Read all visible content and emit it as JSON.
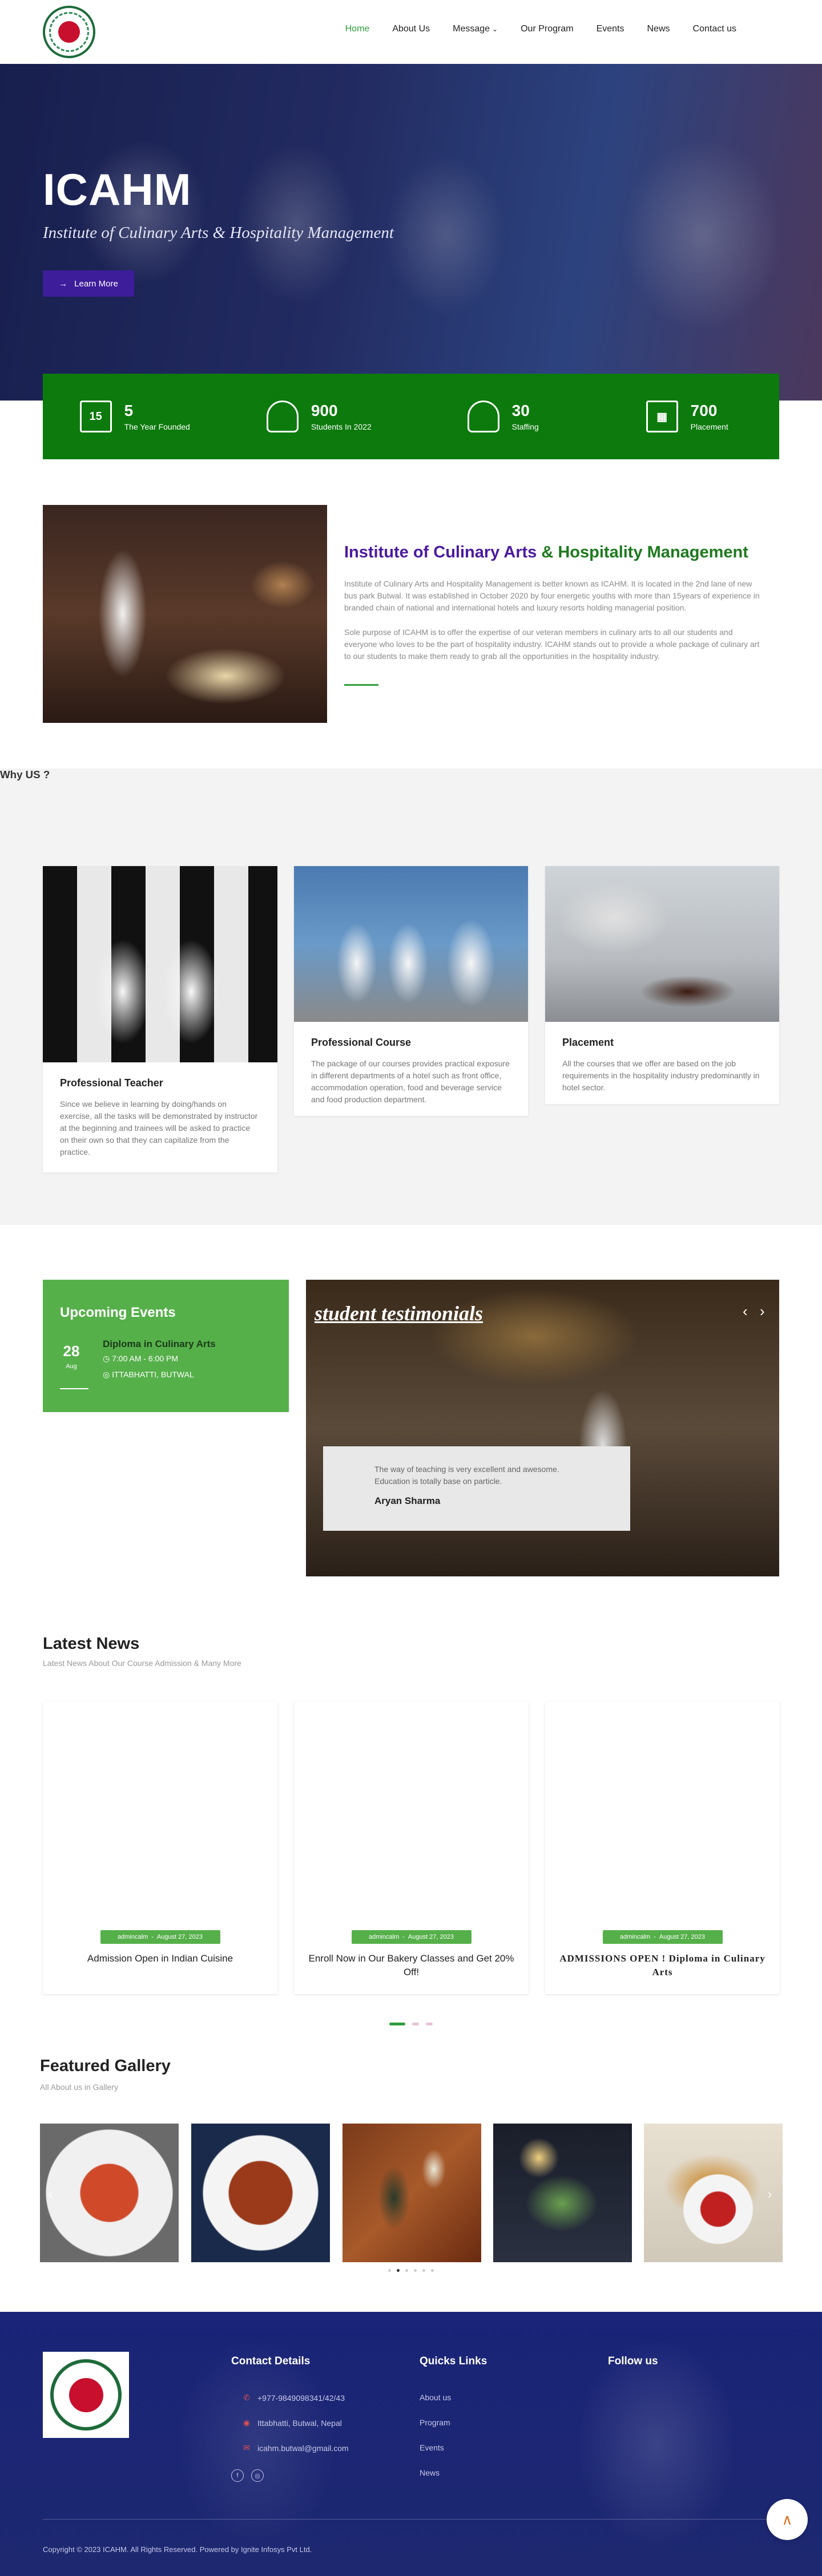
{
  "nav": {
    "items": [
      {
        "label": "Home"
      },
      {
        "label": "About Us"
      },
      {
        "label": "Message"
      },
      {
        "label": "Our Program"
      },
      {
        "label": "Events"
      },
      {
        "label": "News"
      },
      {
        "label": "Contact us"
      }
    ]
  },
  "hero": {
    "title": "ICAHM",
    "subtitle": "Institute of Culinary Arts & Hospitality Management",
    "button": "Learn More"
  },
  "stats": [
    {
      "icon": "calendar-icon",
      "icon_text": "15",
      "value": "5",
      "label": "The Year Founded"
    },
    {
      "icon": "users-icon",
      "icon_text": "",
      "value": "900",
      "label": "Students In 2022"
    },
    {
      "icon": "users-icon",
      "icon_text": "",
      "value": "30",
      "label": "Staffing"
    },
    {
      "icon": "network-icon",
      "icon_text": "",
      "value": "700",
      "label": "Placement"
    }
  ],
  "about": {
    "title_part1": "Institute of Culinary Arts ",
    "title_amp": "&",
    "title_part2": " Hospitality Management",
    "p1": "Institute of Culinary Arts and Hospitality Management is better known as ICAHM. It is located in the 2nd lane of new bus park Butwal. It was established in October 2020 by four energetic youths with more than 15years of experience in branded chain of national and international hotels and luxury resorts holding managerial position.",
    "p2": "Sole purpose of ICAHM is to offer the expertise of our veteran members in culinary arts to all our students and everyone who loves to be the part of hospitality industry. ICAHM stands out to provide a whole package of culinary art to our students to make them ready to grab all the opportunities in the hospitality industry."
  },
  "why": {
    "heading": "Why US ?",
    "cards": [
      {
        "title": "Professional Teacher",
        "text": "Since we believe in learning by doing/hands on exercise, all the tasks will be demonstrated by instructor at the beginning and trainees will be asked to practice on their own so that they can capitalize from the practice."
      },
      {
        "title": "Professional Course",
        "text": "The package of our courses provides practical exposure in different departments of a hotel such as front office, accommodation operation, food and beverage service and food production department."
      },
      {
        "title": "Placement",
        "text": "All the courses that we offer are based on the job requirements in the hospitality industry predominantly in hotel sector."
      }
    ]
  },
  "events": {
    "heading": "Upcoming Events",
    "day": "28",
    "month": "Aug",
    "title": "Diploma in Culinary Arts",
    "time": "7:00 AM - 6:00 PM",
    "location": "ITTABHATTI, BUTWAL"
  },
  "testimonials": {
    "heading": "student testimonials",
    "prev": "‹",
    "next": "›",
    "quote": "The way of teaching is very excellent and awesome. Education is totally base on particle.",
    "author": "Aryan Sharma"
  },
  "news": {
    "heading": "Latest News",
    "subheading": "Latest News About Our Course Admission & Many More",
    "items": [
      {
        "author": "admincalm",
        "date": "August 27, 2023",
        "title": "Admission Open in Indian Cuisine"
      },
      {
        "author": "admincalm",
        "date": "August 27, 2023",
        "title": "Enroll Now in Our Bakery Classes and Get 20% Off!"
      },
      {
        "author": "admincalm",
        "date": "August 27, 2023",
        "title": "ADMISSIONS OPEN ! Diploma in Culinary Arts"
      }
    ]
  },
  "gallery": {
    "heading": "Featured Gallery",
    "subheading": "All About us in Gallery",
    "prev": "‹",
    "next": "›"
  },
  "footer": {
    "contact_heading": "Contact Details",
    "links_heading": "Quicks Links",
    "follow_heading": "Follow us",
    "phone": "+977-9849098341/42/43",
    "address": "Ittabhatti, Butwal, Nepal",
    "email": "icahm.butwal@gmail.com",
    "links": [
      "About us",
      "Program",
      "Events",
      "News"
    ],
    "copyright": "Copyright © 2023 ICAHM. All Rights Reserved. Powered by Ignite Infosys Pvt Ltd."
  },
  "colors": {
    "accent_green": "#0c7a0c",
    "brand_purple": "#3d1d9a",
    "footer_blue": "#1a2478"
  }
}
